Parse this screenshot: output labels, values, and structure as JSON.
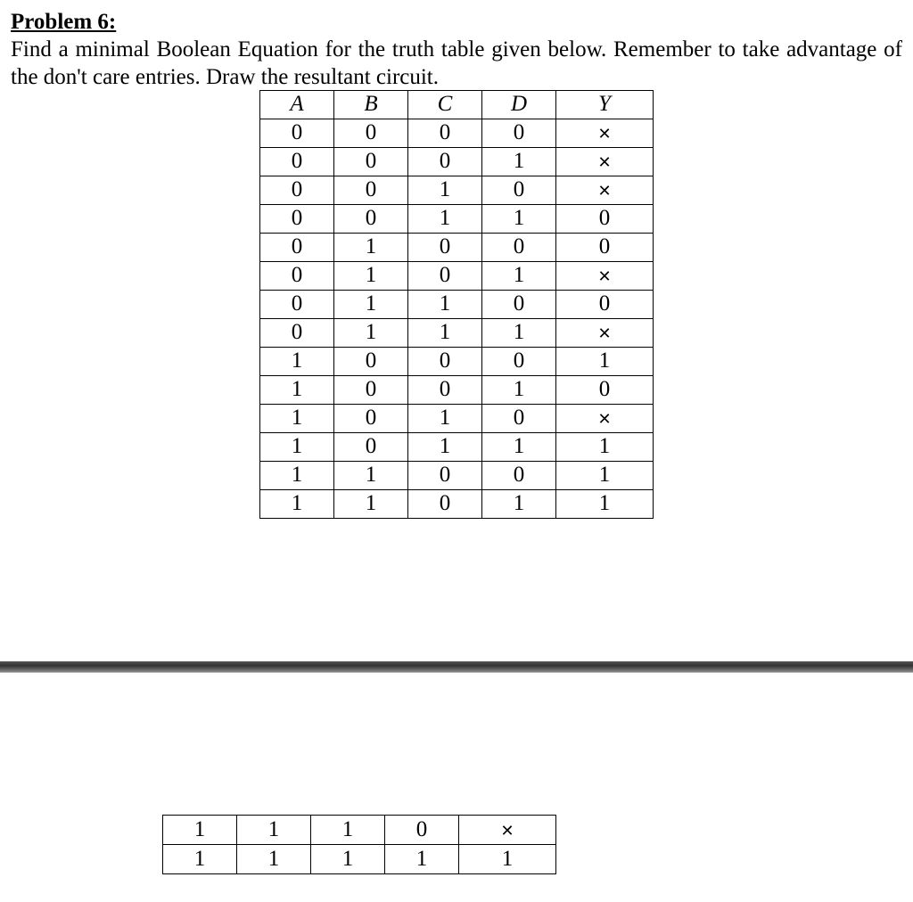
{
  "heading": "Problem 6:",
  "prompt": "Find a minimal Boolean Equation for the truth table given below. Remember to take advantage of the don't care entries. Draw the resultant circuit.",
  "columns": [
    "A",
    "B",
    "C",
    "D",
    "Y"
  ],
  "rows": [
    [
      "0",
      "0",
      "0",
      "0",
      "×"
    ],
    [
      "0",
      "0",
      "0",
      "1",
      "×"
    ],
    [
      "0",
      "0",
      "1",
      "0",
      "×"
    ],
    [
      "0",
      "0",
      "1",
      "1",
      "0"
    ],
    [
      "0",
      "1",
      "0",
      "0",
      "0"
    ],
    [
      "0",
      "1",
      "0",
      "1",
      "×"
    ],
    [
      "0",
      "1",
      "1",
      "0",
      "0"
    ],
    [
      "0",
      "1",
      "1",
      "1",
      "×"
    ],
    [
      "1",
      "0",
      "0",
      "0",
      "1"
    ],
    [
      "1",
      "0",
      "0",
      "1",
      "0"
    ],
    [
      "1",
      "0",
      "1",
      "0",
      "×"
    ],
    [
      "1",
      "0",
      "1",
      "1",
      "1"
    ],
    [
      "1",
      "1",
      "0",
      "0",
      "1"
    ],
    [
      "1",
      "1",
      "0",
      "1",
      "1"
    ]
  ],
  "fragment_rows": [
    [
      "1",
      "1",
      "1",
      "0",
      "×"
    ],
    [
      "1",
      "1",
      "1",
      "1",
      "1"
    ]
  ]
}
